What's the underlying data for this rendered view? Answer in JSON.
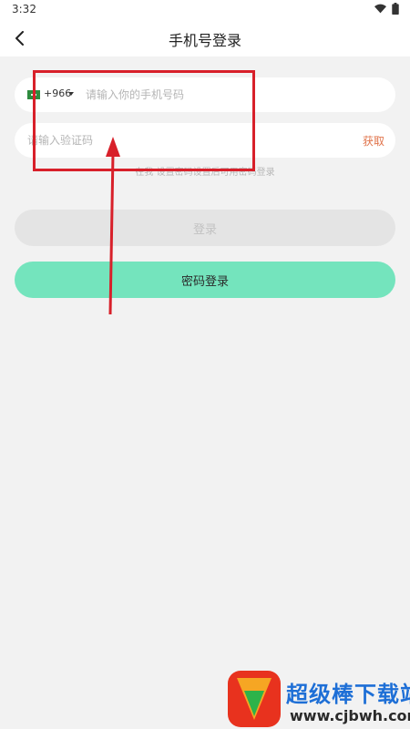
{
  "status_bar": {
    "time": "3:32",
    "icons": [
      "wifi-icon",
      "battery-icon"
    ]
  },
  "nav": {
    "title": "手机号登录",
    "back_icon": "chevron-left-icon"
  },
  "phone_field": {
    "flag_icon": "saudi-flag-icon",
    "country_code": "+966",
    "placeholder": "请输入你的手机号码",
    "value": ""
  },
  "code_field": {
    "placeholder": "请输入验证码",
    "value": "",
    "get_code_label": "获取"
  },
  "hint": "在我 设置密码设置后可用密码登录",
  "buttons": {
    "login_label": "登录",
    "password_login_label": "密码登录"
  },
  "watermark": {
    "name": "超级棒下载站",
    "url": "www.cjbwh.com"
  },
  "colors": {
    "accent_green": "#74e4bd",
    "get_code_orange": "#e0734a",
    "annotation_red": "#d8202a",
    "background": "#f2f2f2"
  }
}
